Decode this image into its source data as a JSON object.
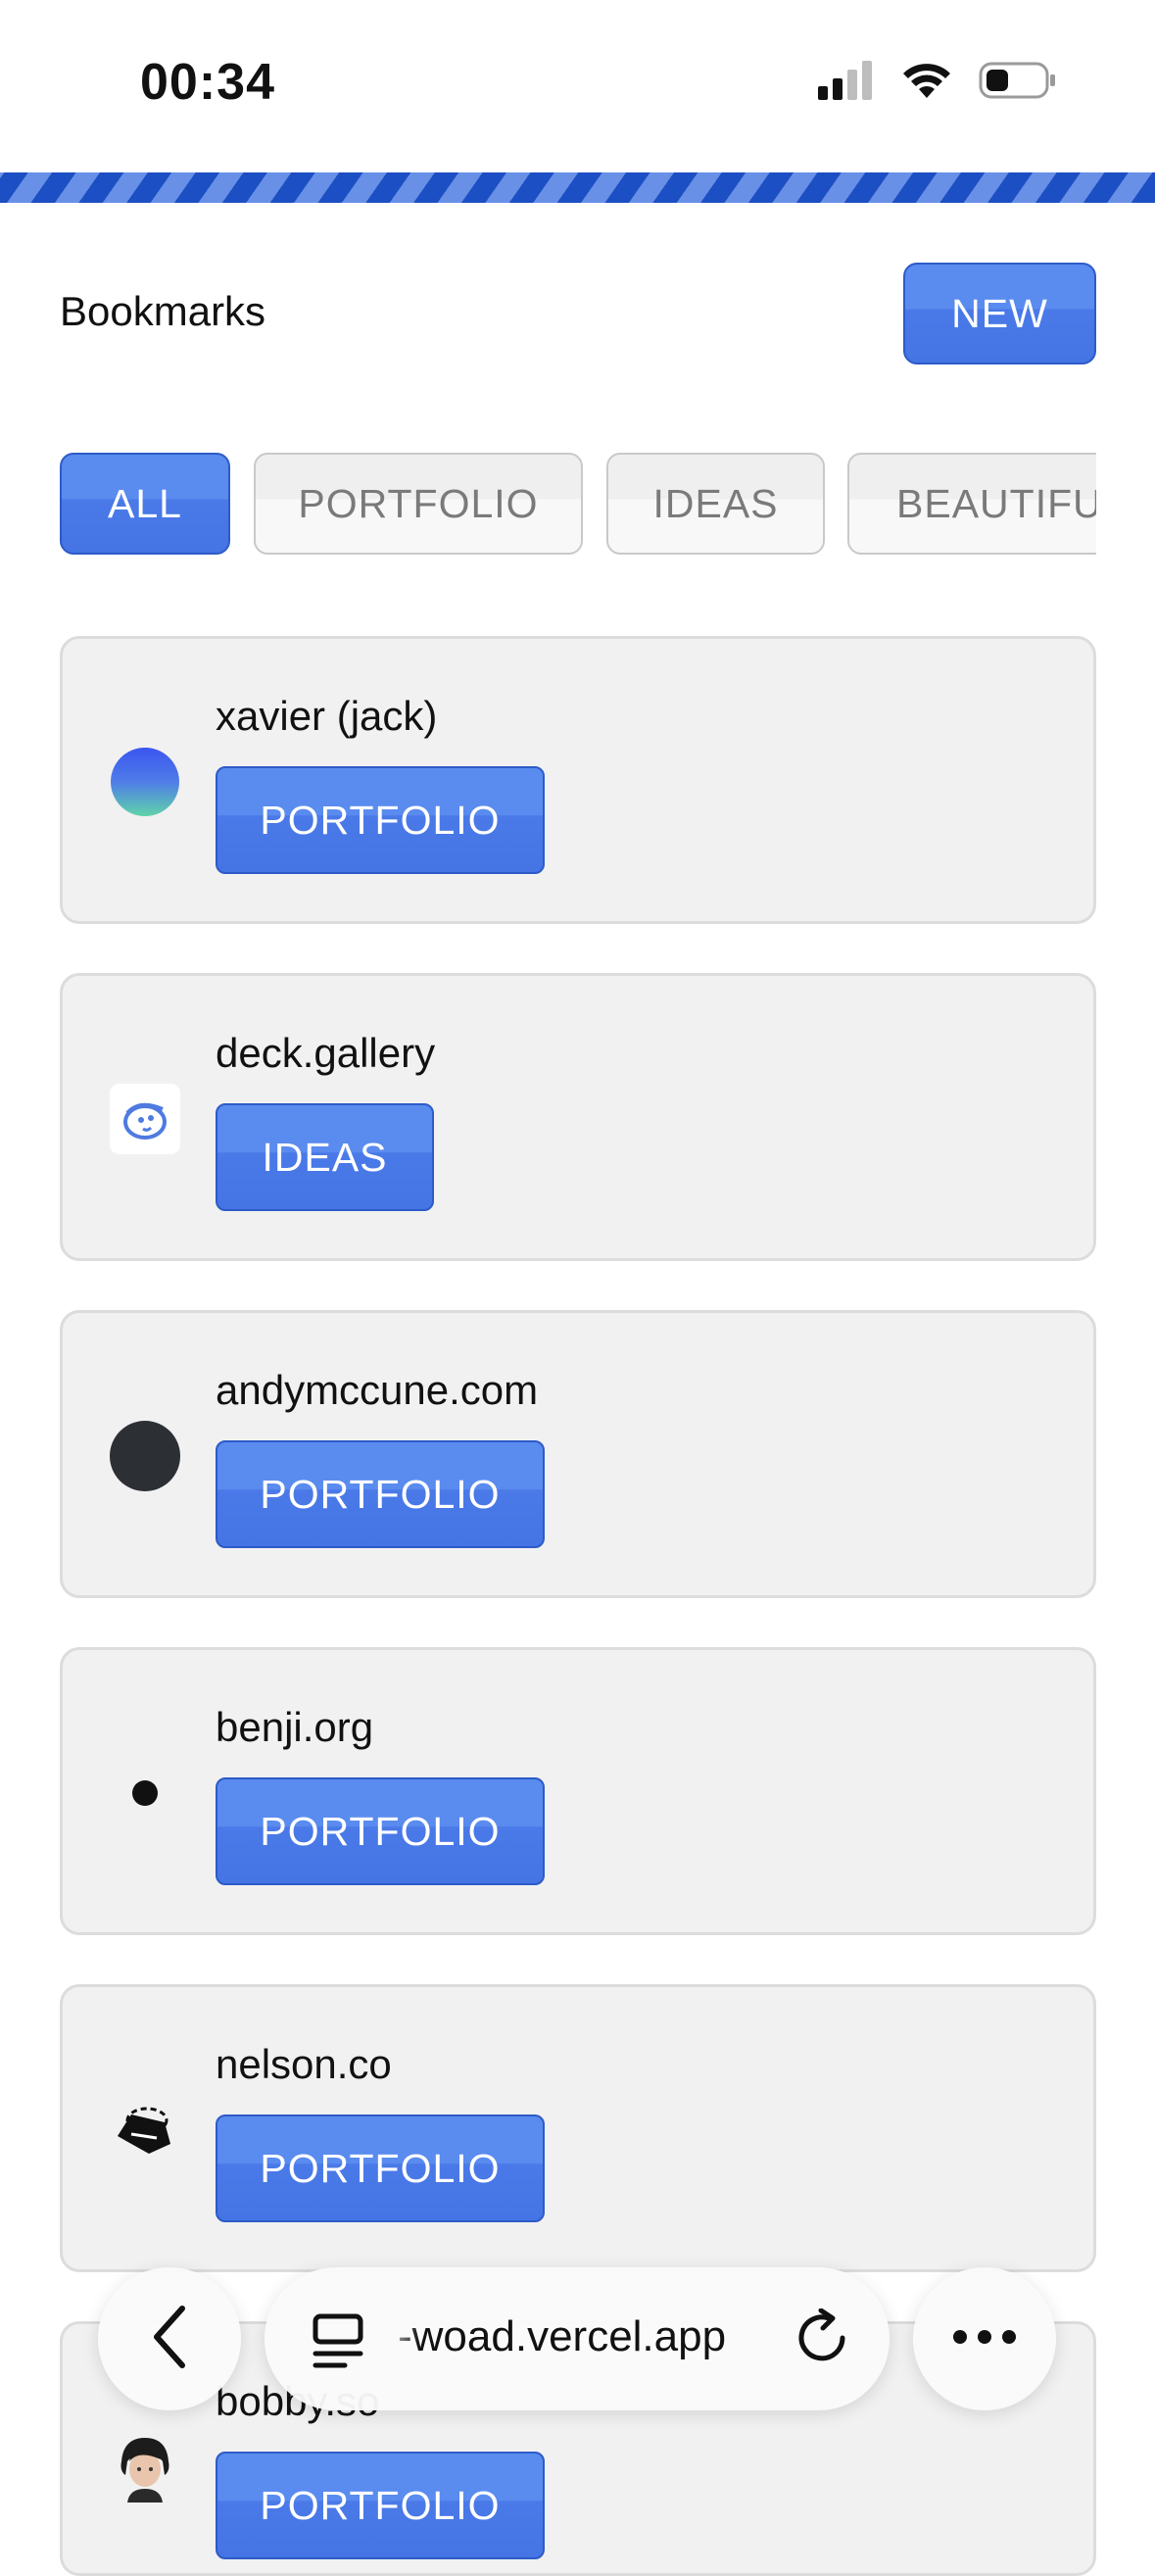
{
  "status_bar": {
    "time": "00:34",
    "battery_level": 0.3
  },
  "header": {
    "title": "Bookmarks",
    "new_label": "NEW"
  },
  "filters": {
    "all": "ALL",
    "portfolio": "PORTFOLIO",
    "ideas": "IDEAS",
    "beautiful": "BEAUTIFUL",
    "active": "ALL"
  },
  "bookmarks": [
    {
      "title": "xavier (jack)",
      "tag": "PORTFOLIO",
      "icon": "gradient-circle-icon"
    },
    {
      "title": "deck.gallery",
      "tag": "IDEAS",
      "icon": "deck-gallery-logo-icon"
    },
    {
      "title": "andymccune.com",
      "tag": "PORTFOLIO",
      "icon": "dark-circle-icon"
    },
    {
      "title": "benji.org",
      "tag": "PORTFOLIO",
      "icon": "small-dot-icon"
    },
    {
      "title": "nelson.co",
      "tag": "PORTFOLIO",
      "icon": "nelson-logo-icon"
    },
    {
      "title": "bobby.so",
      "tag": "PORTFOLIO",
      "icon": "avatar-icon"
    }
  ],
  "browser": {
    "url": "-woad.vercel.app"
  },
  "colors": {
    "accent_blue": "#4a79e8",
    "stripe_dark": "#1d4fc4",
    "stripe_light": "#6790e6",
    "card_bg": "#f1f1f1"
  }
}
